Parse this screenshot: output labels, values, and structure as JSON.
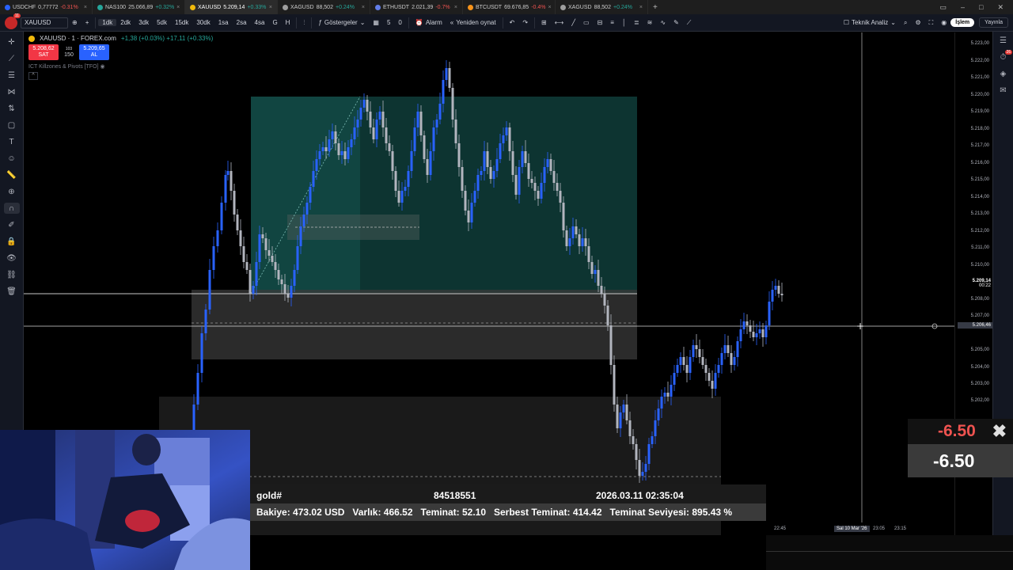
{
  "tabs": [
    {
      "symbol": "USDCHF",
      "price": "0,77772",
      "change": "-0.31%",
      "dir": "dn",
      "color": "#2962ff",
      "active": false
    },
    {
      "symbol": "NAS100",
      "price": "25.066,89",
      "change": "+0.32%",
      "dir": "up",
      "color": "#26a69a",
      "active": false
    },
    {
      "symbol": "XAUUSD",
      "price": "5.209,14",
      "change": "+0.33%",
      "dir": "up",
      "color": "#f0b90b",
      "active": true
    },
    {
      "symbol": "XAGUSD",
      "price": "88,502",
      "change": "+0.24%",
      "dir": "up",
      "color": "#9e9e9e",
      "active": false
    },
    {
      "symbol": "ETHUSDT",
      "price": "2.021,39",
      "change": "-0.7%",
      "dir": "dn",
      "color": "#627eea",
      "active": false
    },
    {
      "symbol": "BTCUSDT",
      "price": "69.676,85",
      "change": "-0.4%",
      "dir": "dn",
      "color": "#f7931a",
      "active": false
    },
    {
      "symbol": "XAGUSD",
      "price": "88,502",
      "change": "+0.24%",
      "dir": "up",
      "color": "#9e9e9e",
      "active": false
    }
  ],
  "toolbar": {
    "avatar_badge": "11",
    "symbol": "XAUUSD",
    "timeframes": [
      "1dk",
      "2dk",
      "3dk",
      "5dk",
      "15dk",
      "30dk",
      "1sa",
      "2sa",
      "4sa",
      "G",
      "H"
    ],
    "active_timeframe": "1dk",
    "indicators_label": "Göstergeler",
    "count1": "5",
    "count2": "0",
    "alarm_label": "Alarm",
    "replay_label": "Yeniden oynat",
    "tech_analysis_label": "Teknik Analiz",
    "trade_label": "İşlem",
    "publish_label": "Yayınla",
    "notif_badge": "26"
  },
  "legend": {
    "title": "XAUUSD · 1 · FOREX.com",
    "change": "+1,38 (+0.03%) +17,11 (+0.33%)",
    "sell_price": "5.208,62",
    "sell_label": "SAT",
    "spread": "103",
    "qty": "150",
    "buy_price": "5.209,65",
    "buy_label": "AL",
    "indicator": "ICT Killzones & Pivots [TFO]",
    "collapse": "^"
  },
  "price_scale": {
    "labels": [
      "5.223,00",
      "5.222,00",
      "5.221,00",
      "5.220,00",
      "5.219,00",
      "5.218,00",
      "5.217,00",
      "5.216,00",
      "5.215,00",
      "5.214,00",
      "5.213,00",
      "5.212,00",
      "5.211,00",
      "5.210,00",
      "5.208,00",
      "5.207,00",
      "5.205,00",
      "5.204,00",
      "5.203,00",
      "5.202,00"
    ],
    "current_price": "5.209,14",
    "countdown": "00:22",
    "crosshair_price": "5.206,46"
  },
  "time_axis": {
    "t1": "22:45",
    "highlight": "Sal 10 Mar '26",
    "t2": "23:05",
    "t3": "23:15"
  },
  "account": {
    "symbol": "gold#",
    "ticket": "84518551",
    "time": "2026.03.11 02:35:04",
    "summary": [
      {
        "label": "Bakiye:",
        "value": "473.02 USD"
      },
      {
        "label": "Varlık:",
        "value": "466.52"
      },
      {
        "label": "Teminat:",
        "value": "52.10"
      },
      {
        "label": "Serbest Teminat:",
        "value": "414.42"
      },
      {
        "label": "Teminat Seviyesi:",
        "value": "895.43 %"
      }
    ]
  },
  "pnl": {
    "top": "-6.50",
    "bottom": "-6.50",
    "close_icon": "✖"
  },
  "colors": {
    "up": "#2962ff",
    "down": "#b2b5be",
    "zone": "#0f3d3a",
    "loss": "#ef5350"
  }
}
